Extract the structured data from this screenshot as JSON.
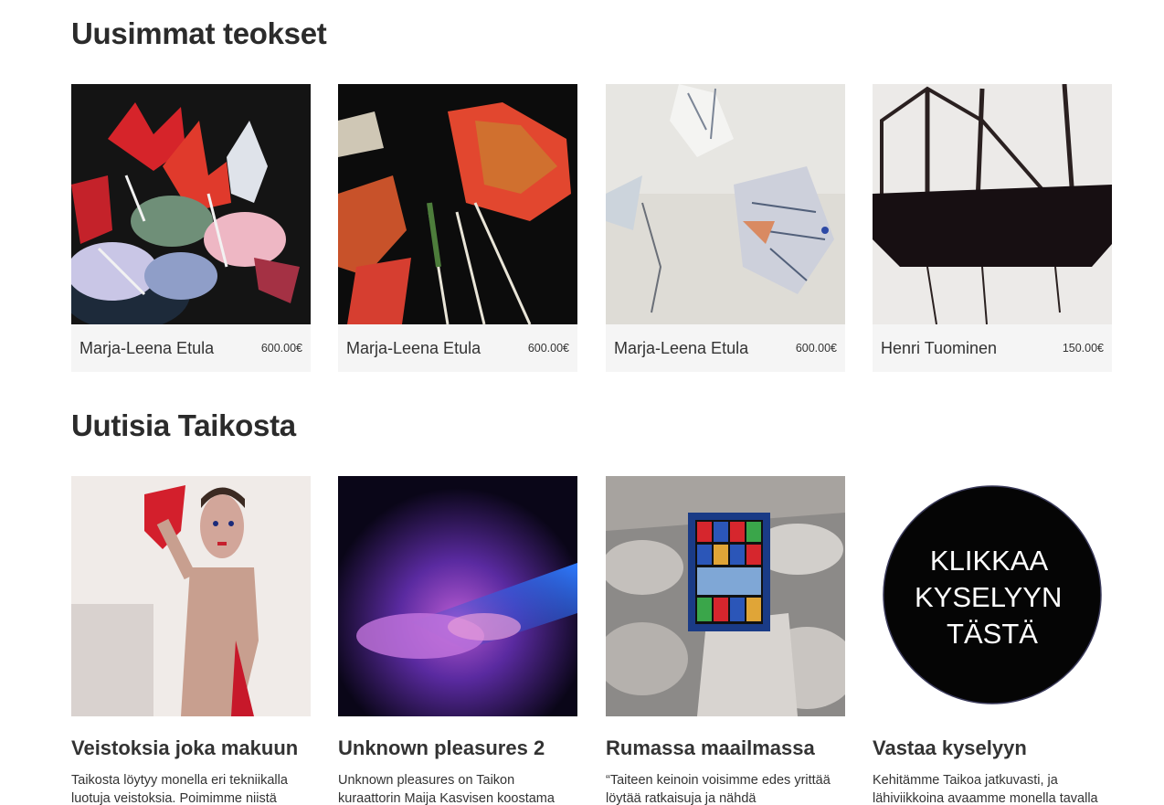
{
  "sections": {
    "works_title": "Uusimmat teokset",
    "news_title": "Uutisia Taikosta"
  },
  "works": [
    {
      "artist": "Marja-Leena Etula",
      "price": "600.00€",
      "image": "red-flowers-painting"
    },
    {
      "artist": "Marja-Leena Etula",
      "price": "600.00€",
      "image": "red-fan-flower-painting"
    },
    {
      "artist": "Marja-Leena Etula",
      "price": "600.00€",
      "image": "pale-flower-painting"
    },
    {
      "artist": "Henri Tuominen",
      "price": "150.00€",
      "image": "sailboat-ink-drawing"
    }
  ],
  "news": [
    {
      "title": "Veistoksia joka makuun",
      "excerpt": "Taikosta löytyy monella eri tekniikalla luotuja veistoksia. Poimimme niistä",
      "image": "figure-sculpture-photo"
    },
    {
      "title": "Unknown pleasures 2",
      "excerpt": "Unknown pleasures on Taikon kuraattorin Maija Kasvisen koostama",
      "image": "purple-blur-photo"
    },
    {
      "title": "Rumassa maailmassa",
      "excerpt": "“Taiteen keinoin voisimme edes yrittää löytää ratkaisuja ja nähdä",
      "image": "stained-glass-rocks-painting"
    },
    {
      "title": "Vastaa kyselyyn",
      "excerpt": "Kehitämme Taikoa jatkuvasti, ja lähiviikkoina avaamme monella tavalla",
      "image": "survey-circle-badge",
      "badge_text": "KLIKKAA KYSELYYN TÄSTÄ"
    }
  ]
}
